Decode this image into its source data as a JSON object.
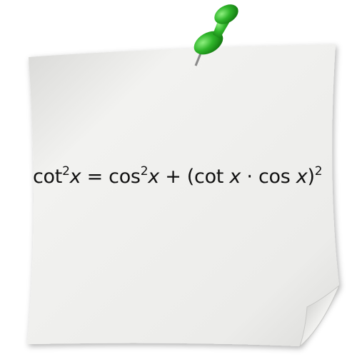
{
  "note": {
    "color": "#eeeeec",
    "equation": {
      "t1": "cot",
      "s1": "2",
      "x1": "x",
      "eq": " = ",
      "t2": "cos",
      "s2": "2",
      "x2": "x",
      "plus": " + (",
      "t3": "cot ",
      "x3": "x",
      "dot": " · ",
      "t4": "cos ",
      "x4": "x",
      "close": ")",
      "s3": "2"
    }
  },
  "pin": {
    "color": "#2fb52a"
  }
}
